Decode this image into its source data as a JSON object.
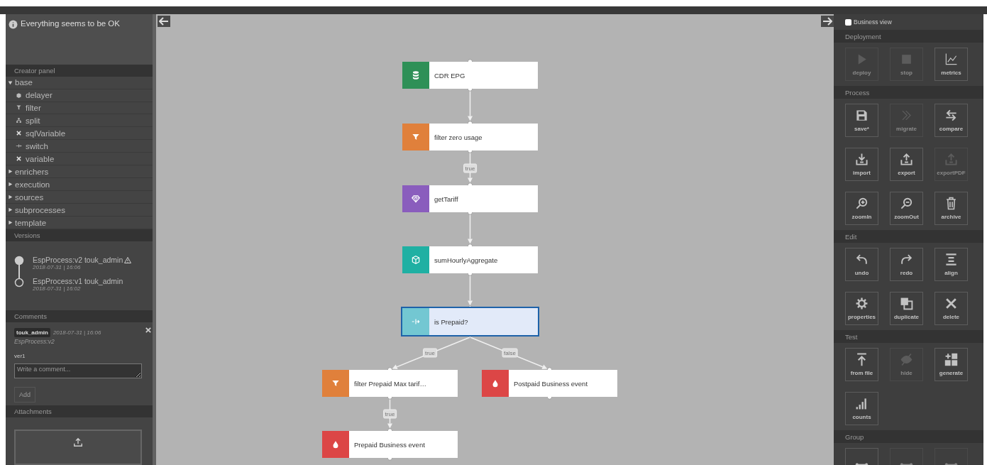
{
  "status": {
    "message": "Everything seems to be OK"
  },
  "creator_panel": {
    "title": "Creator panel",
    "groups": [
      {
        "label": "base",
        "expanded": true,
        "children": [
          {
            "label": "delayer",
            "kind": "cube"
          },
          {
            "label": "filter",
            "kind": "funnel"
          },
          {
            "label": "split",
            "kind": "split"
          },
          {
            "label": "sqlVariable",
            "kind": "cross"
          },
          {
            "label": "switch",
            "kind": "switch"
          },
          {
            "label": "variable",
            "kind": "cross"
          }
        ]
      },
      {
        "label": "enrichers",
        "expanded": false
      },
      {
        "label": "execution",
        "expanded": false
      },
      {
        "label": "sources",
        "expanded": false
      },
      {
        "label": "subprocesses",
        "expanded": false
      },
      {
        "label": "template",
        "expanded": false
      }
    ]
  },
  "versions": {
    "title": "Versions",
    "items": [
      {
        "name": "EspProcess:v2 touk_admin",
        "warning": true,
        "date": "2018-07-31 | 16:06",
        "selected": true
      },
      {
        "name": "EspProcess:v1 touk_admin",
        "warning": false,
        "date": "2018-07-31 | 16:02",
        "selected": false
      }
    ]
  },
  "comments": {
    "title": "Comments",
    "items": [
      {
        "author": "touk_admin",
        "date": "2018-07-31 | 16:06",
        "version": "EspProcess:v2",
        "text": "ver1"
      }
    ],
    "placeholder": "Write a comment...",
    "add_button": {
      "label": "Add",
      "disabled": true
    }
  },
  "attachments": {
    "title": "Attachments"
  },
  "graph": {
    "nodes": [
      {
        "label": "CDR EPG",
        "kind": "source",
        "selected": false
      },
      {
        "label": "filter zero usage",
        "kind": "filter",
        "selected": false
      },
      {
        "label": "getTariff",
        "kind": "enricher",
        "selected": false
      },
      {
        "label": "sumHourlyAggregate",
        "kind": "aggregate",
        "selected": false
      },
      {
        "label": "is Prepaid?",
        "kind": "switch",
        "selected": true
      },
      {
        "label": "filter Prepaid Max tarif…",
        "kind": "filter",
        "selected": false
      },
      {
        "label": "Postpaid Business event",
        "kind": "sink",
        "selected": false
      },
      {
        "label": "Prepaid Business event",
        "kind": "sink",
        "selected": false
      }
    ],
    "edges": [
      {
        "label": "true"
      },
      {
        "label": "true"
      },
      {
        "label": "false"
      },
      {
        "label": "true"
      }
    ]
  },
  "toolbox": {
    "business_view": {
      "label": "Business view",
      "checked": false
    },
    "sections": [
      {
        "title": "Deployment",
        "buttons": [
          {
            "kind": "deploy",
            "label": "deploy",
            "disabled": true
          },
          {
            "kind": "stop",
            "label": "stop",
            "disabled": true
          },
          {
            "kind": "metrics",
            "label": "metrics",
            "disabled": false
          }
        ]
      },
      {
        "title": "Process",
        "buttons": [
          {
            "kind": "save",
            "label": "save*",
            "disabled": false
          },
          {
            "kind": "migrate",
            "label": "migrate",
            "disabled": true
          },
          {
            "kind": "compare",
            "label": "compare",
            "disabled": false
          },
          {
            "kind": "import",
            "label": "import",
            "disabled": false
          },
          {
            "kind": "export",
            "label": "export",
            "disabled": false
          },
          {
            "kind": "export",
            "label": "exportPDF",
            "disabled": true
          },
          {
            "kind": "zoomin",
            "label": "zoomIn",
            "disabled": false
          },
          {
            "kind": "zoomout",
            "label": "zoomOut",
            "disabled": false
          },
          {
            "kind": "archive",
            "label": "archive",
            "disabled": false
          }
        ]
      },
      {
        "title": "Edit",
        "buttons": [
          {
            "kind": "undo",
            "label": "undo",
            "disabled": false
          },
          {
            "kind": "redo",
            "label": "redo",
            "disabled": false
          },
          {
            "kind": "align",
            "label": "align",
            "disabled": false
          },
          {
            "kind": "properties",
            "label": "properties",
            "disabled": false
          },
          {
            "kind": "duplicate",
            "label": "duplicate",
            "disabled": false
          },
          {
            "kind": "delete",
            "label": "delete",
            "disabled": false
          }
        ]
      },
      {
        "title": "Test",
        "buttons": [
          {
            "kind": "fromfile",
            "label": "from file",
            "disabled": false
          },
          {
            "kind": "hide",
            "label": "hide",
            "disabled": true
          },
          {
            "kind": "generate",
            "label": "generate",
            "disabled": false
          },
          {
            "kind": "counts",
            "label": "counts",
            "disabled": false
          }
        ]
      },
      {
        "title": "Group",
        "buttons": [
          {
            "kind": "connector",
            "disabled": false
          },
          {
            "kind": "connector",
            "disabled": true
          },
          {
            "kind": "connector",
            "disabled": true
          }
        ]
      }
    ]
  }
}
